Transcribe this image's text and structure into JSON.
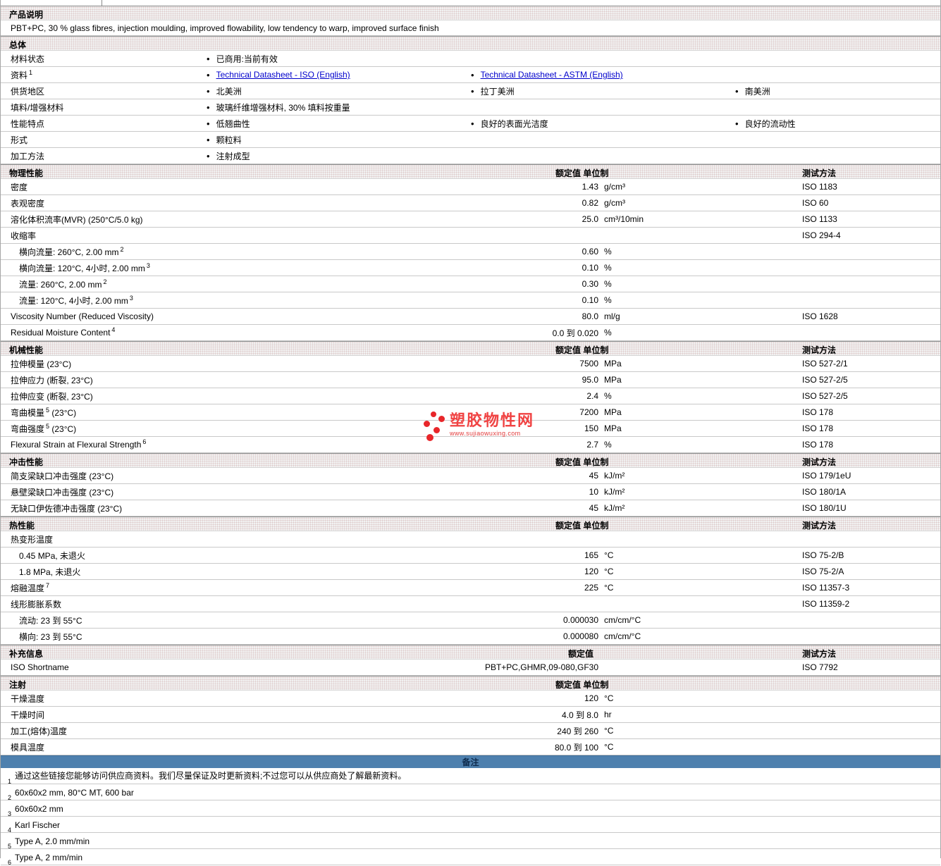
{
  "columns": {
    "value": "额定值",
    "unit": "单位制",
    "method": "测试方法"
  },
  "product": {
    "header": "产品说明",
    "description": "PBT+PC, 30 % glass fibres, injection moulding, improved flowability, low tendency to warp, improved surface finish"
  },
  "general": {
    "header": "总体",
    "rows": [
      {
        "pre": "材料状态",
        "items": [
          {
            "text": "已商用:当前有效"
          }
        ]
      },
      {
        "pre": "资料",
        "sup": "1",
        "items": [
          {
            "text": "Technical Datasheet - ISO (English)"
          },
          {
            "text": "Technical Datasheet - ASTM (English)"
          }
        ]
      },
      {
        "pre": "供货地区",
        "items": [
          {
            "text": "北美洲"
          },
          {
            "text": "拉丁美洲"
          },
          {
            "text": "南美洲"
          }
        ]
      },
      {
        "pre": "填料/增强材料",
        "items": [
          {
            "text": "玻璃纤维增强材料, 30% 填料按重量"
          }
        ]
      },
      {
        "pre": "性能特点",
        "items": [
          {
            "text": "低翘曲性"
          },
          {
            "text": "良好的表面光洁度"
          },
          {
            "text": "良好的流动性"
          }
        ]
      },
      {
        "pre": "形式",
        "items": [
          {
            "text": "颗粒料"
          }
        ]
      },
      {
        "pre": "加工方法",
        "items": [
          {
            "text": "注射成型"
          }
        ]
      }
    ]
  },
  "physical": {
    "header": "物理性能",
    "rows": [
      {
        "pre": "密度",
        "value": "1.43",
        "unit": "g/cm³",
        "method": "ISO 1183"
      },
      {
        "pre": "表观密度",
        "value": "0.82",
        "unit": "g/cm³",
        "method": "ISO 60"
      },
      {
        "pre": "溶化体积流率(MVR) (250°C/5.0 kg)",
        "value": "25.0",
        "unit": "cm³/10min",
        "method": "ISO 1133"
      },
      {
        "pre": "收缩率",
        "method": "ISO 294-4"
      },
      {
        "pre": "横向流量: 260°C, 2.00 mm",
        "sup": "2",
        "value": "0.60",
        "unit": "%"
      },
      {
        "pre": "横向流量: 120°C, 4小时, 2.00 mm",
        "sup": "3",
        "value": "0.10",
        "unit": "%"
      },
      {
        "pre": "流量: 260°C, 2.00 mm",
        "sup": "2",
        "value": "0.30",
        "unit": "%"
      },
      {
        "pre": "流量: 120°C, 4小时, 2.00 mm",
        "sup": "3",
        "value": "0.10",
        "unit": "%"
      },
      {
        "pre": "Viscosity Number (Reduced Viscosity)",
        "value": "80.0",
        "unit": "ml/g",
        "method": "ISO 1628"
      },
      {
        "pre": "Residual Moisture Content",
        "sup": "4",
        "value": "0.0 到 0.020",
        "unit": "%"
      }
    ]
  },
  "mechanical": {
    "header": "机械性能",
    "rows": [
      {
        "pre": "拉伸模量  (23°C)",
        "value": "7500",
        "unit": "MPa",
        "method": "ISO 527-2/1"
      },
      {
        "pre": "拉伸应力  (断裂, 23°C)",
        "value": "95.0",
        "unit": "MPa",
        "method": "ISO 527-2/5"
      },
      {
        "pre": "拉伸应变  (断裂, 23°C)",
        "value": "2.4",
        "unit": "%",
        "method": "ISO 527-2/5"
      },
      {
        "pre": "弯曲模量",
        "sup": "5",
        "post": " (23°C)",
        "value": "7200",
        "unit": "MPa",
        "method": "ISO 178"
      },
      {
        "pre": "弯曲强度",
        "sup": "5",
        "post": " (23°C)",
        "value": "150",
        "unit": "MPa",
        "method": "ISO 178"
      },
      {
        "pre": "Flexural Strain at Flexural Strength",
        "sup": "6",
        "value": "2.7",
        "unit": "%",
        "method": "ISO 178"
      }
    ]
  },
  "impact": {
    "header": "冲击性能",
    "rows": [
      {
        "pre": "简支梁缺口冲击强度  (23°C)",
        "value": "45",
        "unit": "kJ/m²",
        "method": "ISO 179/1eU"
      },
      {
        "pre": "悬壁梁缺口冲击强度  (23°C)",
        "value": "10",
        "unit": "kJ/m²",
        "method": "ISO 180/1A"
      },
      {
        "pre": "无缺口伊佐德冲击强度  (23°C)",
        "value": "45",
        "unit": "kJ/m²",
        "method": "ISO 180/1U"
      }
    ]
  },
  "thermal": {
    "header": "热性能",
    "rows": [
      {
        "pre": "热变形温度"
      },
      {
        "pre": "0.45 MPa, 未退火",
        "value": "165",
        "unit": "°C",
        "method": "ISO 75-2/B"
      },
      {
        "pre": "1.8 MPa, 未退火",
        "value": "120",
        "unit": "°C",
        "method": "ISO 75-2/A"
      },
      {
        "pre": "熔融温度",
        "sup": "7",
        "value": "225",
        "unit": "°C",
        "method": "ISO 11357-3"
      },
      {
        "pre": "线形膨胀系数",
        "method": "ISO 11359-2"
      },
      {
        "pre": "流动: 23 到  55°C",
        "value": "0.000030",
        "unit": "cm/cm/°C"
      },
      {
        "pre": "横向: 23 到  55°C",
        "value": "0.000080",
        "unit": "cm/cm/°C"
      }
    ]
  },
  "supplemental": {
    "header": "补充信息",
    "rows": [
      {
        "pre": "ISO Shortname",
        "value": "PBT+PC,GHMR,09-080,GF30",
        "method": "ISO 7792"
      }
    ]
  },
  "injection": {
    "header": "注射",
    "rows": [
      {
        "pre": "干燥温度",
        "value": "120",
        "unit": "°C"
      },
      {
        "pre": "干燥时间",
        "value": "4.0 到  8.0",
        "unit": "hr"
      },
      {
        "pre": "加工(熔体)温度",
        "value": "240 到  260",
        "unit": "°C"
      },
      {
        "pre": "模具温度",
        "value": "80.0 到  100",
        "unit": "°C"
      }
    ]
  },
  "remarks": {
    "header": "备注",
    "notes": [
      {
        "sup": "1",
        "text": "通过这些链接您能够访问供应商资料。我们尽量保证及时更新资料;不过您可以从供应商处了解最新资料。"
      },
      {
        "sup": "2",
        "text": "60x60x2 mm, 80°C MT, 600 bar"
      },
      {
        "sup": "3",
        "text": "60x60x2 mm"
      },
      {
        "sup": "4",
        "text": "Karl Fischer"
      },
      {
        "sup": "5",
        "text": "Type A, 2.0 mm/min"
      },
      {
        "sup": "6",
        "text": "Type A, 2 mm/min"
      }
    ]
  },
  "watermark": {
    "title": "塑胶物性网",
    "url": "www.sujiaowuxing.com"
  },
  "colors": {
    "accent_blue": "#4e80ae",
    "link_blue": "#0000cc",
    "watermark_red": "#e8262a"
  }
}
